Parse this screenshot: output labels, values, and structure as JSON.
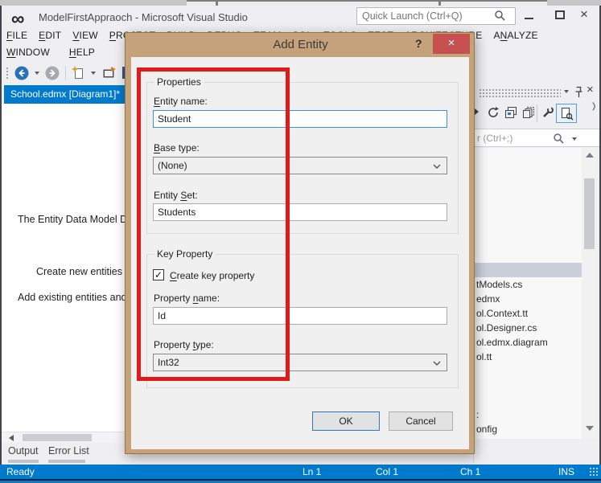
{
  "colors": {
    "accent_blue": "#007ACC",
    "chrome_bg": "#EFEFF2",
    "dialog_frame_tan": "#C5A27A",
    "dialog_close_red": "#C75050",
    "annotation_red": "#DF1A1A",
    "tree_selection": "#CCCEDB",
    "focused_input_border": "#3D8FD8"
  },
  "icons": {
    "vs_logo": "infinity-mark",
    "search": "magnifier",
    "back": "circle-left-arrow",
    "forward": "circle-right-arrow",
    "pin": "pushpin",
    "close": "×",
    "chevron_down": "v",
    "checkmark": "✓"
  },
  "titlebar": {
    "title": "ModelFirstAppraoch - Microsoft Visual Studio",
    "quick_launch_placeholder": "Quick Launch (Ctrl+Q)"
  },
  "menu": {
    "row1": [
      {
        "text": "FILE",
        "accel": 0
      },
      {
        "text": "EDIT",
        "accel": 0
      },
      {
        "text": "VIEW",
        "accel": 0
      },
      {
        "text": "PROJECT",
        "accel": 0
      },
      {
        "text": "BUILD",
        "accel": 0
      },
      {
        "text": "DEBUG",
        "accel": 0
      },
      {
        "text": "TEAM",
        "accel": 1
      },
      {
        "text": "SQL",
        "accel": 1
      },
      {
        "text": "TOOLS",
        "accel": 0
      },
      {
        "text": "TEST",
        "accel": 1
      },
      {
        "text": "ARCHITECTURE",
        "accel": 2
      },
      {
        "text": "ANALYZE",
        "accel": 1
      }
    ],
    "row2": [
      {
        "text": "WINDOW",
        "accel": 0
      },
      {
        "text": "HELP",
        "accel": 0
      }
    ]
  },
  "editor": {
    "tab_label": "School.edmx [Diagram1]*",
    "watermark_lines": [
      "The Entity Data Model De",
      "Create new entities in",
      "Add existing entities and r"
    ]
  },
  "solution_explorer": {
    "search_fragment": "r (Ctrl+;)",
    "items": [
      {
        "label": "",
        "row": 0,
        "selected": true
      },
      {
        "label": "tModels.cs",
        "row": 1
      },
      {
        "label": "edmx",
        "row": 2
      },
      {
        "label": "ol.Context.tt",
        "row": 3
      },
      {
        "label": "ol.Designer.cs",
        "row": 4
      },
      {
        "label": "ol.edmx.diagram",
        "row": 5
      },
      {
        "label": "ol.tt",
        "row": 6
      },
      {
        "label": ":",
        "row": 10
      },
      {
        "label": "onfig",
        "row": 11
      }
    ]
  },
  "bottom_tabs": {
    "output": "Output",
    "error_list": "Error List"
  },
  "statusbar": {
    "ready": "Ready",
    "ln": "Ln 1",
    "col": "Col 1",
    "ch": "Ch 1",
    "ins": "INS"
  },
  "dialog": {
    "title": "Add Entity",
    "help": "?",
    "close": "×",
    "properties_group": {
      "legend": "Properties",
      "entity_name_label": {
        "text": "Entity name:",
        "accel": 0
      },
      "entity_name_value": "Student",
      "base_type_label": {
        "text": "Base type:",
        "accel": 0
      },
      "base_type_value": "(None)",
      "entity_set_label": {
        "text": "Entity Set:",
        "accel": 7
      },
      "entity_set_value": "Students"
    },
    "key_group": {
      "legend": "Key Property",
      "checkbox_label": {
        "text": "Create key property",
        "accel": 0
      },
      "checkbox_checked": true,
      "property_name_label": {
        "text": "Property name:",
        "accel": 9
      },
      "property_name_value": "Id",
      "property_type_label": {
        "text": "Property type:",
        "accel": 9
      },
      "property_type_value": "Int32"
    },
    "ok_label": "OK",
    "cancel_label": "Cancel"
  }
}
